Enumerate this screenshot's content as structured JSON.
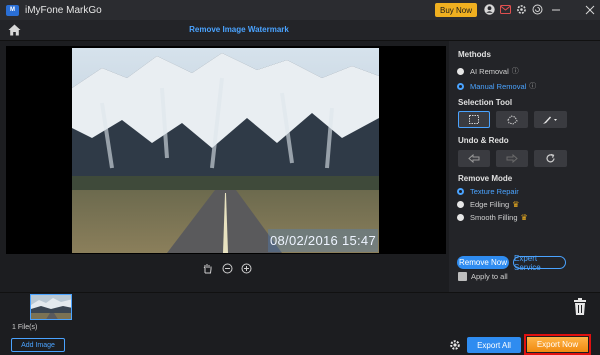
{
  "app": {
    "title": "iMyFone MarkGo",
    "logo_text": "M"
  },
  "titlebar": {
    "buy_now": "Buy Now",
    "icons": [
      "user-icon",
      "mail-icon",
      "settings-icon",
      "refresh-icon",
      "minimize-icon",
      "close-icon"
    ]
  },
  "header": {
    "page_title": "Remove Image Watermark"
  },
  "preview": {
    "watermark_text": "08/02/2016 15:47"
  },
  "panel": {
    "methods_label": "Methods",
    "methods": [
      {
        "label": "AI Removal",
        "selected": false
      },
      {
        "label": "Manual Removal",
        "selected": true
      }
    ],
    "selection_tool_label": "Selection Tool",
    "undo_redo_label": "Undo & Redo",
    "remove_mode_label": "Remove Mode",
    "modes": [
      {
        "label": "Texture Repair",
        "selected": true,
        "premium": false
      },
      {
        "label": "Edge Filling",
        "selected": false,
        "premium": true
      },
      {
        "label": "Smooth Filling",
        "selected": false,
        "premium": true
      }
    ],
    "remove_now": "Remove Now",
    "expert_service": "Expert Service",
    "apply_to_all": "Apply to all"
  },
  "bottom": {
    "file_count": "1 File(s)",
    "add_image": "Add Image",
    "export_all": "Export All",
    "export_now": "Export Now"
  },
  "colors": {
    "accent": "#2f8cf0",
    "link": "#4aa3ff",
    "buy_now": "#f0b020",
    "export_now": "#f08a10",
    "highlight_border": "#e01010"
  }
}
